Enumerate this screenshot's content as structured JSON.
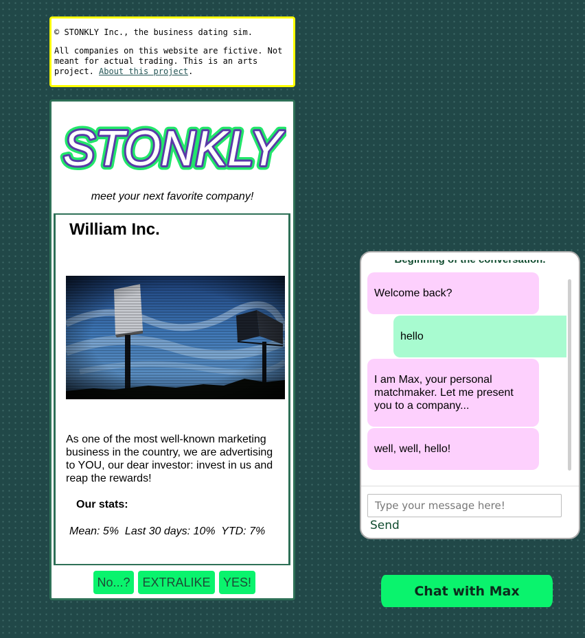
{
  "disclaimer": {
    "line1": "© STONKLY Inc., the business dating sim.",
    "line2": "All companies on this website are fictive. Not meant for actual trading. This is an arts project.",
    "link": "About this project",
    "after_link": "."
  },
  "brand": {
    "logo_text": "STONKLY",
    "tagline": "meet your next favorite company!",
    "logo_colors": {
      "fill": "#ffffff",
      "inner_stroke": "#5a3aa8",
      "outer_stroke": "#22e66a"
    }
  },
  "company": {
    "name": "William Inc.",
    "description": "As one of the most well-known marketing business in the country, we are advertising to YOU, our dear investor: invest in us and reap the rewards!",
    "stats_title": "Our stats:",
    "stats_line": "Mean: 5%  Last 30 days: 10%  YTD: 7%"
  },
  "actions": {
    "no": "No...?",
    "extralike": "EXTRALIKE",
    "yes": "YES!"
  },
  "chat": {
    "header": "Beginning of the conversation.",
    "messages": [
      {
        "from": "bot",
        "text": "Welcome back?"
      },
      {
        "from": "user",
        "text": "hello"
      },
      {
        "from": "bot",
        "text": "I am Max, your personal matchmaker. Let me present you to a company..."
      },
      {
        "from": "bot",
        "text": "well, well, hello!"
      }
    ],
    "input_placeholder": "Type your message here!",
    "send_label": "Send"
  },
  "chat_button": "Chat with Max",
  "colors": {
    "background": "#214848",
    "disclaimer_border": "#ffff00",
    "card_border": "#2e7057",
    "button_green": "#0af36d",
    "bot_bubble": "#fdd0fd",
    "user_bubble": "#a8fbd0"
  }
}
